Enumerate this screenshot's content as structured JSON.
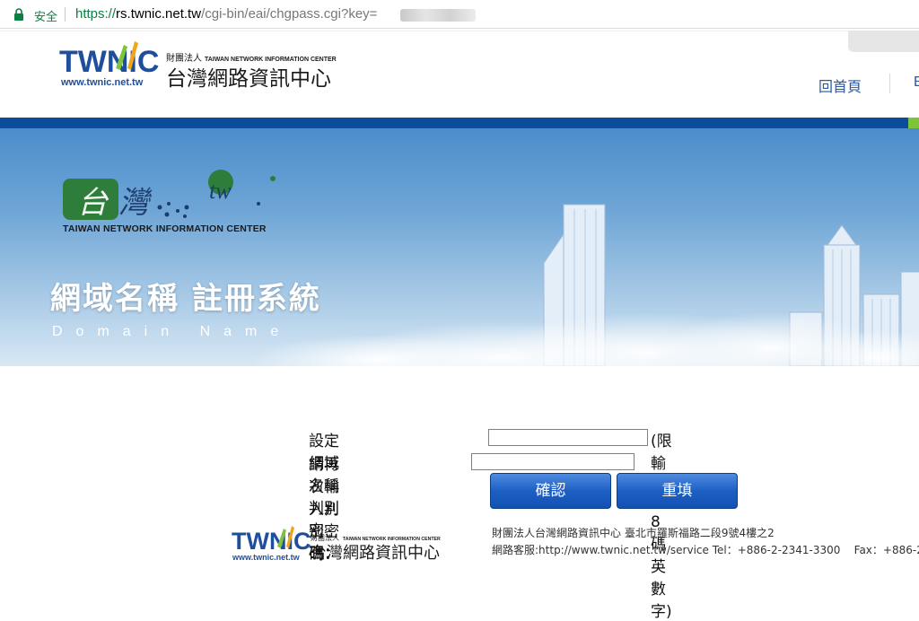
{
  "browser": {
    "secure_label": "安全",
    "url_proto": "https://",
    "url_host": "rs.twnic.net.tw",
    "url_rest": "/cgi-bin/eai/chgpass.cgi?key="
  },
  "header": {
    "logo_mark": "TWNIC",
    "logo_url": "www.twnic.net.tw",
    "logo_org_small": "財團法人",
    "logo_org_en": "TAIWAN NETWORK INFORMATION CENTER",
    "logo_org_zh": "台灣網路資訊中心",
    "nav_home": "回首頁",
    "nav_more": "E"
  },
  "banner": {
    "emblem_tw": "tw",
    "org_en": "TAIWAN NETWORK INFORMATION CENTER",
    "title": "網域名稱 註冊系統",
    "subtitle": "Domain Name"
  },
  "form": {
    "password_label": "設定網域名稱判別密碼：",
    "password_hint": "(限輸入6-8碼英數字)",
    "confirm_label": "請再次輸入判別密碼：",
    "submit_label": "確認",
    "reset_label": "重填"
  },
  "footer": {
    "logo_mark": "TWNIC",
    "logo_url": "www.twnic.net.tw",
    "logo_org_small": "財團法人",
    "logo_org_en": "TAIWAN NETWORK INFORMATION CENTER",
    "logo_org_zh": "台灣網路資訊中心",
    "address": "財團法人台灣網路資訊中心 臺北市羅斯福路二段9號4樓之2",
    "service_label": "網路客服:",
    "service_url": "http://www.twnic.net.tw/service",
    "tel": " Tel：+886-2-2341-3300",
    "fax": "Fax：+886-2-"
  },
  "colors": {
    "brand_blue": "#0b4d9a",
    "button_blue": "#1d5fc4",
    "accent_green": "#7cc53b"
  }
}
